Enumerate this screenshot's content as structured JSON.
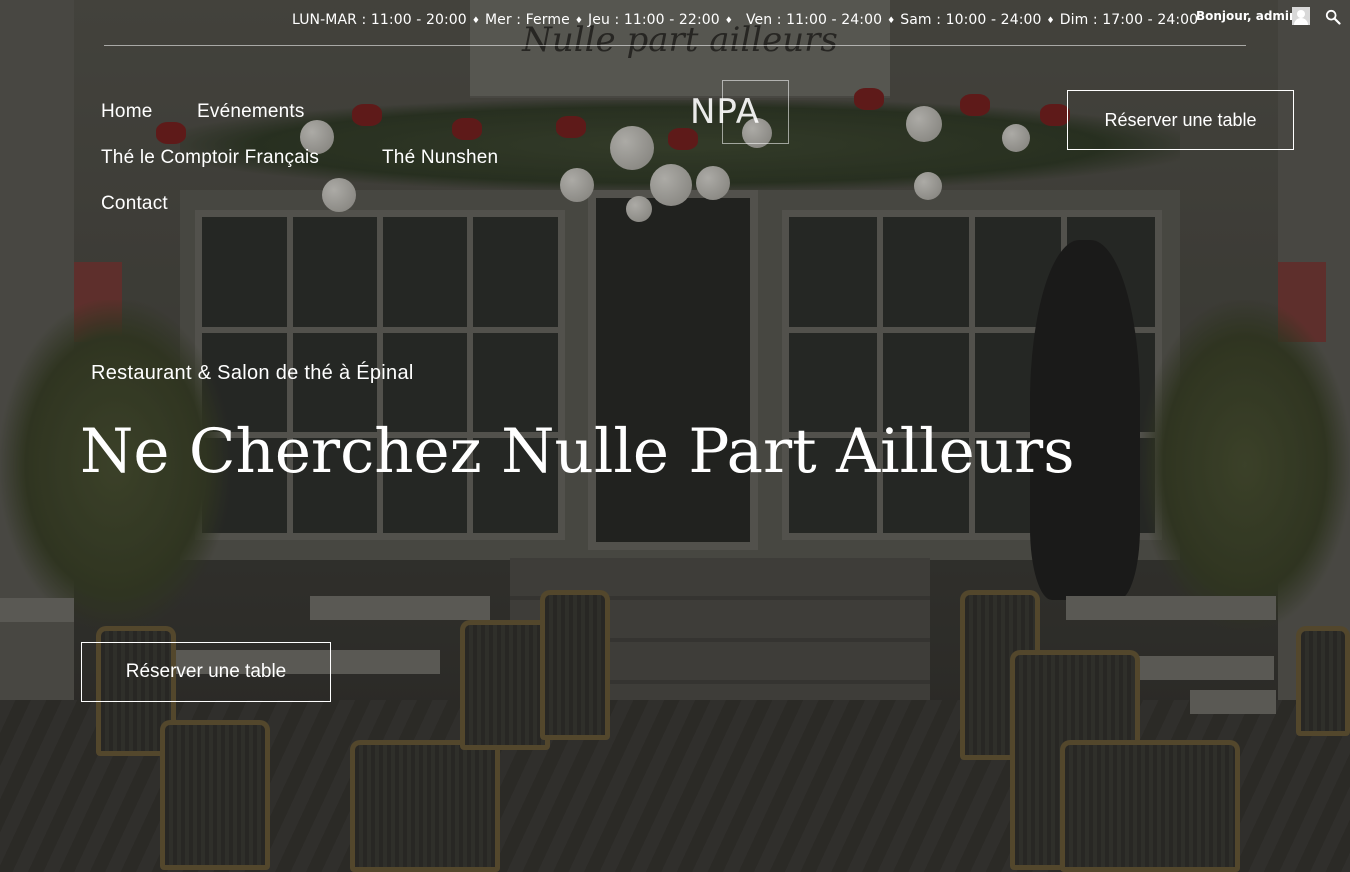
{
  "topbar": {
    "hours": [
      "LUN-MAR : 11:00 - 20:00",
      "Mer : Ferme",
      "Jeu : 11:00 - 22:00",
      "Ven : 11:00 - 24:00",
      "Sam : 10:00 - 24:00",
      "Dim : 17:00 - 24:00"
    ],
    "separator": "♦",
    "admin_greeting": "Bonjour, admin"
  },
  "background_sign": "Nulle part ailleurs",
  "nav": {
    "items": [
      {
        "label": "Home"
      },
      {
        "label": "Evénements"
      },
      {
        "label": "Thé le Comptoir Français"
      },
      {
        "label": "Thé Nunshen"
      },
      {
        "label": "Contact"
      }
    ]
  },
  "logo": {
    "text": "NPA"
  },
  "header_cta": {
    "label": "Réserver une table"
  },
  "hero": {
    "subtitle": "Restaurant & Salon de thé à Épinal",
    "title": "Ne Cherchez Nulle Part Ailleurs",
    "cta_label": "Réserver une table"
  },
  "icons": {
    "search": "search-icon",
    "avatar": "avatar"
  }
}
